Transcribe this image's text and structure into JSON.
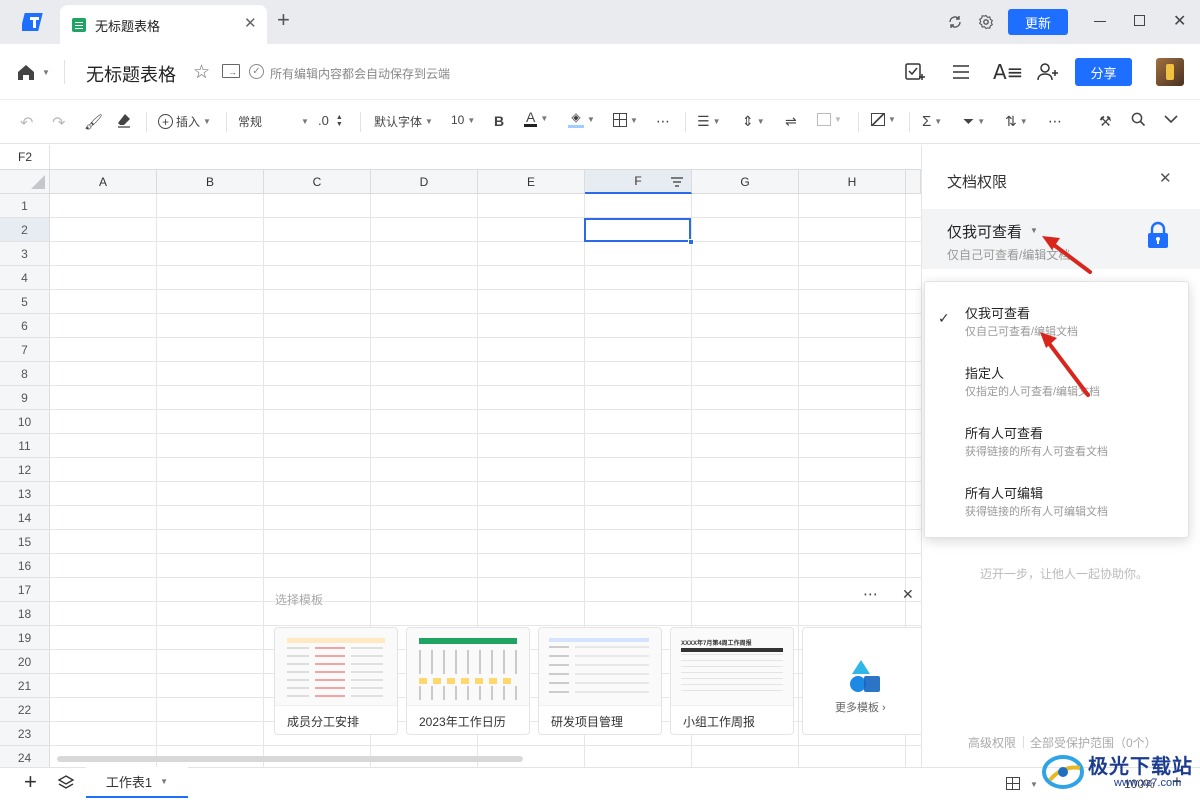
{
  "titlebar": {
    "tab_title": "无标题表格",
    "update_label": "更新"
  },
  "doc": {
    "title": "无标题表格",
    "autosave_text": "所有编辑内容都会自动保存到云端",
    "share_label": "分享"
  },
  "toolbar": {
    "insert_label": "插入",
    "format_value": "常规",
    "decimal_label": ".0",
    "font_value": "默认字体",
    "font_size_value": "10",
    "bold_label": "B",
    "font_color_label": "A"
  },
  "grid": {
    "cell_ref": "F2",
    "columns": [
      "A",
      "B",
      "C",
      "D",
      "E",
      "F",
      "G",
      "H"
    ],
    "rows": [
      "1",
      "2",
      "3",
      "4",
      "5",
      "6",
      "7",
      "8",
      "9",
      "10",
      "11",
      "12",
      "13",
      "14",
      "15",
      "16",
      "17",
      "18",
      "19",
      "20",
      "21",
      "22",
      "23",
      "24"
    ],
    "selected_cell": "F2"
  },
  "templates": {
    "heading": "选择模板",
    "cards": [
      {
        "label": "成员分工安排"
      },
      {
        "label": "2023年工作日历"
      },
      {
        "label": "研发项目管理"
      },
      {
        "label": "小组工作周报"
      }
    ],
    "more_label": "更多模板",
    "weekly_thumb_title": "XXXX年7月第4周工作周报"
  },
  "permission_panel": {
    "title": "文档权限",
    "current_value": "仅我可查看",
    "current_desc": "仅自己可查看/编辑文档",
    "options": [
      {
        "title": "仅我可查看",
        "desc": "仅自己可查看/编辑文档",
        "checked": true
      },
      {
        "title": "指定人",
        "desc": "仅指定的人可查看/编辑文档",
        "checked": false
      },
      {
        "title": "所有人可查看",
        "desc": "获得链接的所有人可查看文档",
        "checked": false
      },
      {
        "title": "所有人可编辑",
        "desc": "获得链接的所有人可编辑文档",
        "checked": false
      }
    ],
    "hint": "迈开一步，让他人一起协助你。",
    "advanced_label": "高级权限",
    "protect_label": "全部受保护范围（0个）"
  },
  "bottom": {
    "sheet_tab": "工作表1",
    "zoom_value": "100%"
  },
  "watermark": {
    "text": "极光下载站",
    "url": "www.xz7.com"
  },
  "colors": {
    "accent": "#1e6fff",
    "arrow": "#d9261c",
    "selection": "#2a6be8"
  }
}
